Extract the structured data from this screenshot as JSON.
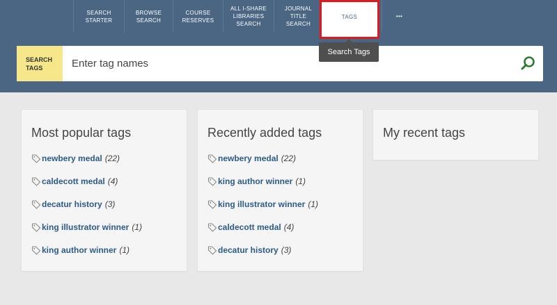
{
  "nav": {
    "tabs": [
      {
        "label": "SEARCH\nSTARTER"
      },
      {
        "label": "BROWSE\nSEARCH"
      },
      {
        "label": "COURSE\nRESERVES"
      },
      {
        "label": "ALL I-SHARE\nLIBRARIES\nSEARCH"
      },
      {
        "label": "JOURNAL\nTITLE\nSEARCH"
      },
      {
        "label": "TAGS"
      },
      {
        "label": "•••"
      }
    ],
    "tooltip": "Search Tags"
  },
  "search": {
    "label": "SEARCH\nTAGS",
    "placeholder": "Enter tag names"
  },
  "panels": {
    "popular": {
      "title": "Most popular tags",
      "tags": [
        {
          "name": "newbery medal",
          "count": "(22)"
        },
        {
          "name": "caldecott medal",
          "count": "(4)"
        },
        {
          "name": "decatur history",
          "count": "(3)"
        },
        {
          "name": "king illustrator winner",
          "count": "(1)"
        },
        {
          "name": "king author winner",
          "count": "(1)"
        }
      ]
    },
    "recent": {
      "title": "Recently added tags",
      "tags": [
        {
          "name": "newbery medal",
          "count": "(22)"
        },
        {
          "name": "king author winner",
          "count": "(1)"
        },
        {
          "name": "king illustrator winner",
          "count": "(1)"
        },
        {
          "name": "caldecott medal",
          "count": "(4)"
        },
        {
          "name": "decatur history",
          "count": "(3)"
        }
      ]
    },
    "mine": {
      "title": "My recent tags"
    }
  },
  "colors": {
    "header_bg": "#4a6683",
    "highlight_border": "#e0191e",
    "search_label_bg": "#f5e78a",
    "tag_link": "#2c5b89",
    "search_icon": "#2e7d32"
  }
}
